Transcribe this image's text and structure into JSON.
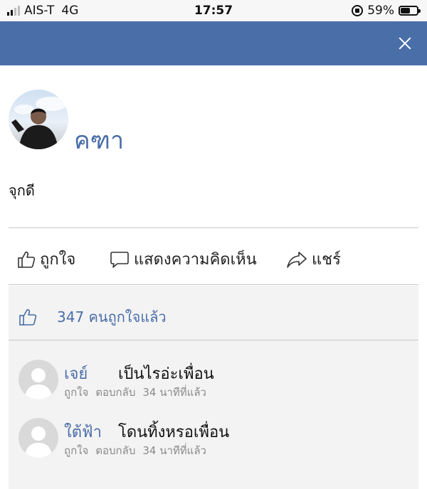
{
  "status_bar": {
    "carrier": "AIS-T",
    "network": "4G",
    "time": "17:57",
    "battery": "59%",
    "battery_level": 0.59
  },
  "header": {
    "close_icon": "close-icon"
  },
  "post": {
    "author": "คฑา",
    "text": "จุกดี"
  },
  "actions": {
    "like": "ถูกใจ",
    "comment": "แสดงความคิดเห็น",
    "share": "แชร์"
  },
  "likes": {
    "summary": "347 คนถูกใจแล้ว"
  },
  "comments": [
    {
      "name": "เจย์",
      "text": "เป็นไรอ่ะเพื่อน",
      "like": "ถูกใจ",
      "reply": "ตอบกลับ",
      "time": "34 นาทีที่แล้ว"
    },
    {
      "name": "ใต้ฟ้า",
      "text": "โดนทิ้งหรอเพื่อน",
      "like": "ถูกใจ",
      "reply": "ตอบกลับ",
      "time": "34 นาทีที่แล้ว"
    }
  ],
  "colors": {
    "brand": "#4a6ea8",
    "meta": "#8a8a8a",
    "panel": "#f3f3f3"
  }
}
